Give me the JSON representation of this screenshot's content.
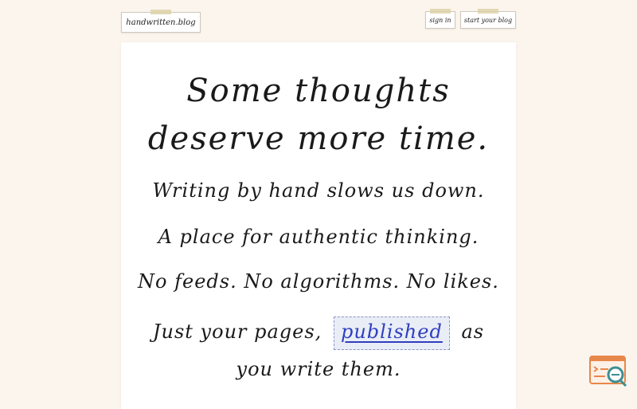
{
  "header": {
    "logo_text": "handwritten.blog",
    "sign_in_label": "sign in",
    "start_blog_label": "start your blog"
  },
  "hero": {
    "title_line1": "Some thoughts",
    "title_line2": "deserve more time."
  },
  "content": {
    "line1": "Writing by hand slows us down.",
    "line2": "A place for authentic thinking.",
    "line3": "No feeds. No algorithms. No likes.",
    "line4_before": "Just your pages,",
    "line4_highlight": "published",
    "line4_after": "as",
    "line5": "you write them."
  },
  "colors": {
    "background": "#fbf5ee",
    "paper": "#ffffff",
    "ink": "#1a1a1a",
    "accent": "#2f3fbf",
    "widget_orange": "#e8874a",
    "widget_teal": "#3b8f93"
  },
  "icons": {
    "widget": "search-document-icon"
  }
}
